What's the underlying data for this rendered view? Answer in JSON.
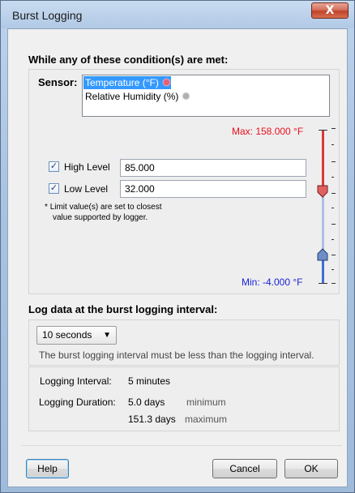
{
  "window": {
    "title": "Burst Logging",
    "close_glyph": "X"
  },
  "conditions": {
    "heading": "While any of these condition(s) are met:",
    "sensor_label": "Sensor:",
    "sensors": [
      {
        "label": "Temperature (°F)",
        "selected": true,
        "icon": "sun-icon",
        "icon_color": "#e2607a"
      },
      {
        "label": "Relative Humidity (%)",
        "selected": false,
        "icon": "sun-icon",
        "icon_color": "#a6a6a6"
      }
    ],
    "max_label": "Max: 158.000 °F",
    "min_label": "Min: -4.000 °F",
    "high": {
      "checked": true,
      "label": "High Level",
      "value": "85.000"
    },
    "low": {
      "checked": true,
      "label": "Low Level",
      "value": "32.000"
    },
    "note_star": "*",
    "note_line1": "Limit value(s) are set to closest",
    "note_line2": "value supported by logger.",
    "colors": {
      "high_track": "#d93a3a",
      "low_track": "#3f6fd0",
      "mid_track": "#a9c0e8"
    }
  },
  "interval": {
    "heading": "Log data at the burst logging interval:",
    "selected": "10 seconds",
    "hint": "The burst logging interval must be less than the logging interval.",
    "logging_interval_label": "Logging Interval:",
    "logging_interval_value": "5 minutes",
    "logging_duration_label": "Logging Duration:",
    "duration_min_value": "5.0 days",
    "duration_min_label": "minimum",
    "duration_max_value": "151.3 days",
    "duration_max_label": "maximum"
  },
  "buttons": {
    "help": "Help",
    "cancel": "Cancel",
    "ok": "OK"
  },
  "colors": {
    "max_color": "#e8101c",
    "min_color": "#1a23d6",
    "selection": "#3399ff"
  }
}
